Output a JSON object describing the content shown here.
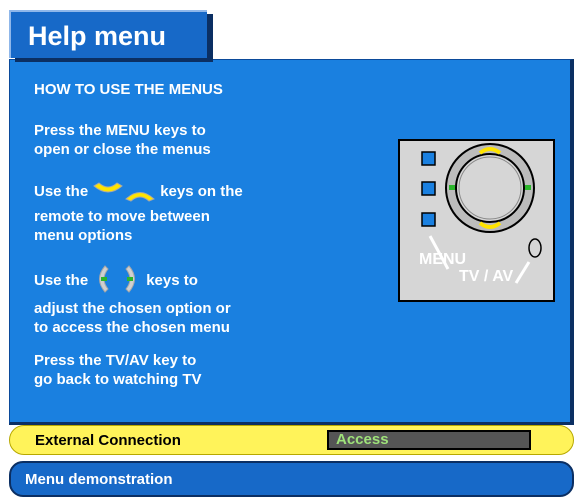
{
  "header": {
    "title": "Help menu"
  },
  "help": {
    "heading": "HOW TO USE THE MENUS",
    "menu_instruction": {
      "line1": "Press the MENU keys to",
      "line2": "open or close the menus"
    },
    "updown_instruction": {
      "prefix": "Use the",
      "suffix": "keys on the",
      "line2": "remote to move between",
      "line3": "menu options"
    },
    "leftright_instruction": {
      "prefix": "Use the",
      "suffix": "keys to",
      "line2": "adjust the chosen option or",
      "line3": "to access the chosen menu"
    },
    "tvav_instruction": {
      "line1": "Press the TV/AV key to",
      "line2": "go back to watching TV"
    }
  },
  "remote": {
    "menu_label": "MENU",
    "tvav_label": "TV / AV"
  },
  "icons": {
    "up_down_arrows": "up-down-arrow-keys-icon",
    "left_right_arrows": "left-right-arrow-keys-icon"
  },
  "colors": {
    "panel": "#1a80e0",
    "arrow_yellow": "#ffe400",
    "arrow_green": "#2bb52b",
    "highlight_bar": "#fff35a"
  },
  "external_connection": {
    "label": "External Connection",
    "value": "Access"
  },
  "footer": {
    "label": "Menu demonstration"
  }
}
